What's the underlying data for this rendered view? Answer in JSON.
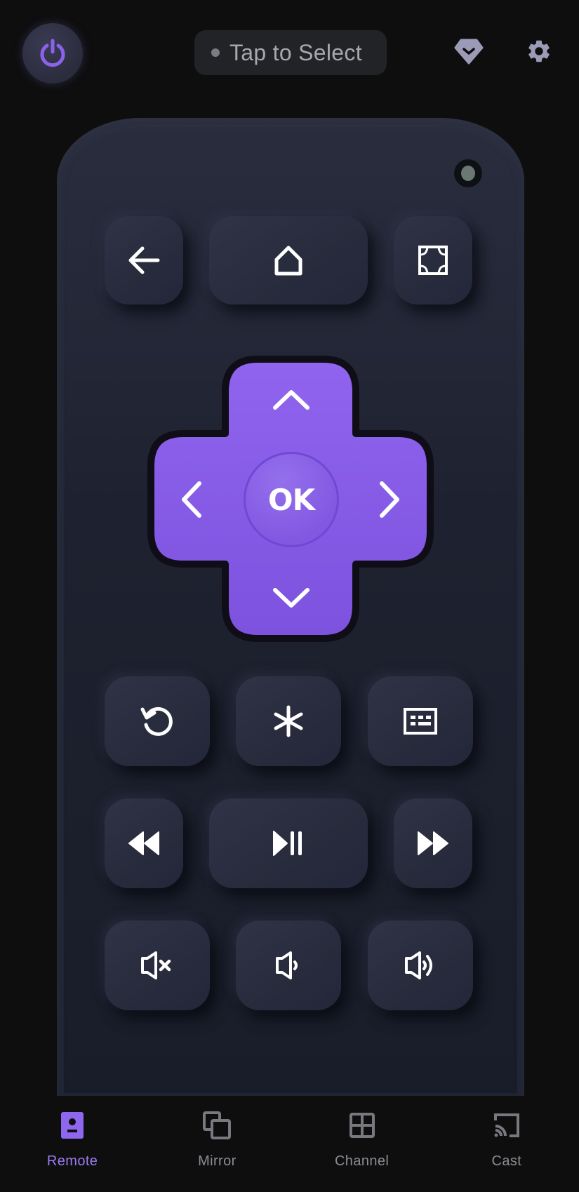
{
  "header": {
    "power_icon": "power-icon",
    "device_selector": {
      "status_dot_color": "#7b7c82",
      "label": "Tap to Select"
    },
    "premium_icon": "diamond-chevron-icon",
    "settings_icon": "gear-icon"
  },
  "colors": {
    "accent": "#8b5fe8",
    "background": "#0e0e0f",
    "remote_body": "#1f2331",
    "key": "#2a2e41",
    "inactive_nav": "#8c8c93",
    "active_nav": "#9a7cf0"
  },
  "remote": {
    "row1": [
      {
        "name": "back",
        "icon": "arrow-left-icon"
      },
      {
        "name": "home",
        "icon": "home-icon"
      },
      {
        "name": "fullscreen",
        "icon": "fullscreen-icon"
      }
    ],
    "dpad": {
      "ok_label": "OK",
      "up_icon": "chevron-up-icon",
      "down_icon": "chevron-down-icon",
      "left_icon": "chevron-left-icon",
      "right_icon": "chevron-right-icon"
    },
    "row2": [
      {
        "name": "replay",
        "icon": "replay-icon"
      },
      {
        "name": "options",
        "icon": "asterisk-icon"
      },
      {
        "name": "keyboard",
        "icon": "keyboard-icon"
      }
    ],
    "row3": [
      {
        "name": "rewind",
        "icon": "rewind-icon"
      },
      {
        "name": "play-pause",
        "icon": "play-pause-icon"
      },
      {
        "name": "fast-forward",
        "icon": "fast-forward-icon"
      }
    ],
    "row4": [
      {
        "name": "mute",
        "icon": "volume-mute-icon"
      },
      {
        "name": "volume-down",
        "icon": "volume-down-icon"
      },
      {
        "name": "volume-up",
        "icon": "volume-up-icon"
      }
    ]
  },
  "nav": {
    "active": "Remote",
    "items": [
      {
        "label": "Remote",
        "icon": "remote-icon"
      },
      {
        "label": "Mirror",
        "icon": "mirror-icon"
      },
      {
        "label": "Channel",
        "icon": "channel-grid-icon"
      },
      {
        "label": "Cast",
        "icon": "cast-icon"
      }
    ]
  }
}
